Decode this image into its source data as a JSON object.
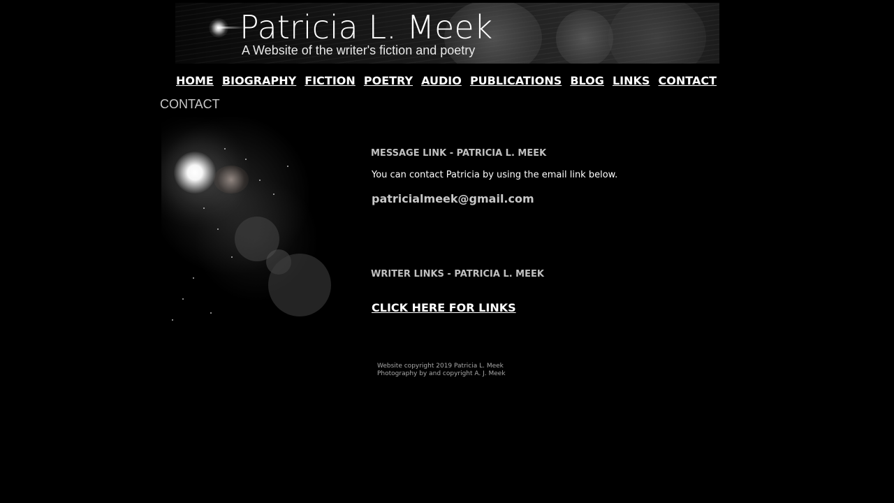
{
  "header": {
    "title": "Patricia L. Meek",
    "subtitle": "A Website of the writer's fiction and poetry"
  },
  "nav": {
    "items": [
      {
        "label": "HOME"
      },
      {
        "label": "BIOGRAPHY"
      },
      {
        "label": "FICTION"
      },
      {
        "label": "POETRY"
      },
      {
        "label": "AUDIO"
      },
      {
        "label": "PUBLICATIONS"
      },
      {
        "label": "BLOG"
      },
      {
        "label": "LINKS"
      },
      {
        "label": "CONTACT"
      }
    ]
  },
  "page": {
    "heading": "CONTACT"
  },
  "message_section": {
    "heading": "MESSAGE LINK - PATRICIA L. MEEK",
    "text": "You can contact Patricia by using the email link below.",
    "email": "patricialmeek@gmail.com"
  },
  "writer_section": {
    "heading": "WRITER LINKS - PATRICIA L. MEEK",
    "cta": "CLICK HERE FOR LINKS"
  },
  "footer": {
    "copyright": "Website copyright 2019 Patricia L. Meek",
    "photo_credit": "Photography by and copyright A. J. Meek"
  },
  "colors": {
    "background": "#000000",
    "text": "#ffffff",
    "muted_text": "#c0c0c0"
  }
}
